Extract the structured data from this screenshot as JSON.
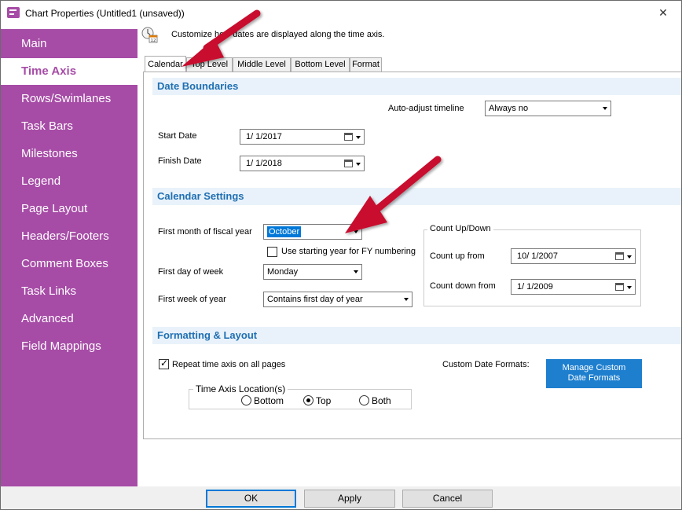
{
  "window": {
    "title": "Chart Properties (Untitled1 (unsaved))"
  },
  "sidebar": {
    "items": [
      {
        "label": "Main",
        "active": false
      },
      {
        "label": "Time Axis",
        "active": true
      },
      {
        "label": "Rows/Swimlanes",
        "active": false
      },
      {
        "label": "Task Bars",
        "active": false
      },
      {
        "label": "Milestones",
        "active": false
      },
      {
        "label": "Legend",
        "active": false
      },
      {
        "label": "Page Layout",
        "active": false
      },
      {
        "label": "Headers/Footers",
        "active": false
      },
      {
        "label": "Comment Boxes",
        "active": false
      },
      {
        "label": "Task Links",
        "active": false
      },
      {
        "label": "Advanced",
        "active": false
      },
      {
        "label": "Field Mappings",
        "active": false
      }
    ]
  },
  "info": {
    "text": "Customize how dates are displayed along the time axis."
  },
  "tabs": [
    {
      "label": "Calendar",
      "active": true
    },
    {
      "label": "Top Level",
      "active": false
    },
    {
      "label": "Middle Level",
      "active": false
    },
    {
      "label": "Bottom Level",
      "active": false
    },
    {
      "label": "Format",
      "active": false
    }
  ],
  "date_boundaries": {
    "header": "Date Boundaries",
    "auto_adjust_label": "Auto-adjust timeline",
    "auto_adjust_value": "Always no",
    "start_label": "Start Date",
    "start_value": "1/  1/2017",
    "finish_label": "Finish Date",
    "finish_value": "1/  1/2018"
  },
  "calendar_settings": {
    "header": "Calendar Settings",
    "fiscal_month_label": "First month of fiscal year",
    "fiscal_month_value": "October",
    "fy_numbering_label": "Use starting year for FY numbering",
    "fy_numbering_checked": false,
    "first_day_label": "First day of week",
    "first_day_value": "Monday",
    "first_week_label": "First week of year",
    "first_week_value": "Contains first day of year",
    "count_group_label": "Count Up/Down",
    "count_up_label": "Count up from",
    "count_up_value": "10/  1/2007",
    "count_down_label": "Count down from",
    "count_down_value": "1/  1/2009"
  },
  "formatting": {
    "header": "Formatting & Layout",
    "repeat_label": "Repeat time axis on all pages",
    "repeat_checked": true,
    "custom_formats_label": "Custom Date Formats:",
    "manage_button_line1": "Manage  Custom",
    "manage_button_line2": "Date Formats",
    "location_group_label": "Time Axis Location(s)",
    "location_options": [
      {
        "label": "Bottom",
        "checked": false
      },
      {
        "label": "Top",
        "checked": true
      },
      {
        "label": "Both",
        "checked": false
      }
    ]
  },
  "footer": {
    "ok_label": "OK",
    "apply_label": "Apply",
    "cancel_label": "Cancel"
  },
  "colors": {
    "sidebar": "#a64ca6",
    "section_text": "#1f6fb2",
    "section_bg": "#e9f2fa",
    "accent_button": "#1e7fcf",
    "annotation_arrow": "#c8102e"
  },
  "icons": {
    "app": "app-icon",
    "close": "close-icon",
    "info": "calendar-info-icon",
    "calendar": "calendar-picker-icon",
    "dropdown": "chevron-down-icon"
  }
}
